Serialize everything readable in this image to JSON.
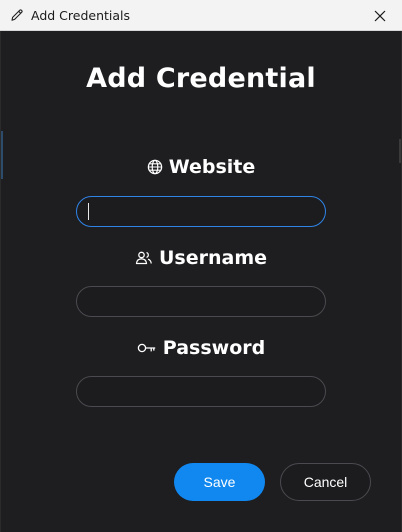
{
  "window": {
    "title": "Add Credentials",
    "title_icon": "edit-pencil-icon",
    "close_icon": "close-icon"
  },
  "form": {
    "heading": "Add Credential",
    "fields": [
      {
        "label": "Website",
        "icon": "globe-icon",
        "value": "",
        "placeholder": ""
      },
      {
        "label": "Username",
        "icon": "users-icon",
        "value": "",
        "placeholder": ""
      },
      {
        "label": "Password",
        "icon": "key-icon",
        "value": "",
        "placeholder": ""
      }
    ]
  },
  "buttons": {
    "save": "Save",
    "cancel": "Cancel"
  },
  "colors": {
    "accent": "#1188f0",
    "focus_border": "#2f84e8",
    "background": "#1e1e20"
  }
}
